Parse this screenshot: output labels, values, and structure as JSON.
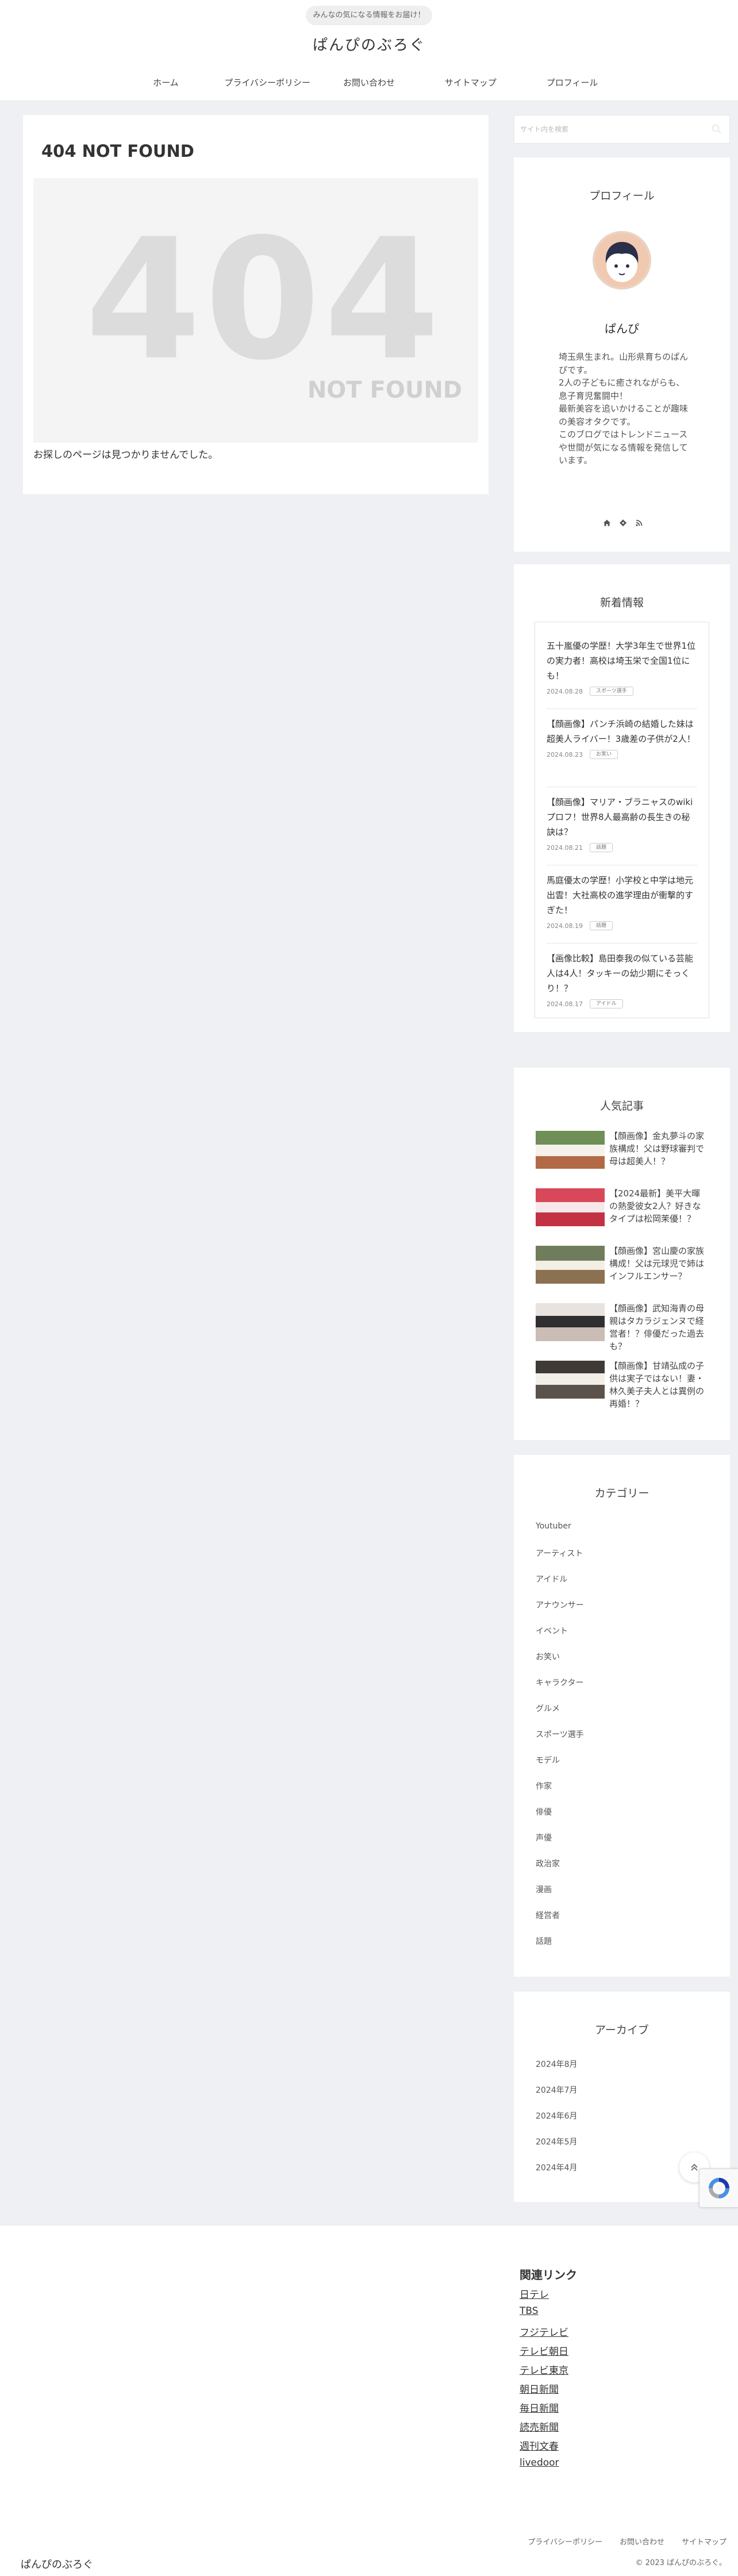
{
  "header": {
    "tagline": "みんなの気になる情報をお届け！",
    "site_title": "ぱんぴのぶろぐ",
    "nav": [
      "ホーム",
      "プライバシーポリシー",
      "お問い合わせ",
      "サイトマップ",
      "プロフィール"
    ]
  },
  "main": {
    "title": "404 NOT FOUND",
    "image_big": "404",
    "image_small": "NOT FOUND",
    "message": "お探しのページは見つかりませんでした。"
  },
  "search": {
    "placeholder": "サイト内を検索"
  },
  "profile": {
    "title": "プロフィール",
    "name": "ぱんぴ",
    "bio": [
      "埼玉県生まれ。山形県育ちのぱんぴです。",
      "2人の子どもに癒されながらも、息子育児奮闘中！",
      "最新美容を追いかけることが趣味の美容オタクです。",
      "このブログではトレンドニュースや世間が気になる情報を発信しています。"
    ],
    "icons": [
      "home-icon",
      "feedly-icon",
      "rss-icon"
    ]
  },
  "newest": {
    "title": "新着情報",
    "items": [
      {
        "title": "五十嵐優の学歴！大学3年生で世界1位の実力者！高校は埼玉栄で全国1位にも！",
        "date": "2024.08.28",
        "category": "スポーツ選手"
      },
      {
        "title": "【顔画像】パンチ浜崎の結婚した妹は超美人ライバー！3歳差の子供が2人！",
        "date": "2024.08.23",
        "category": "お笑い"
      },
      {
        "title": "【顔画像】マリア・ブラニャスのwikiプロフ！世界8人最高齢の長生きの秘訣は？",
        "date": "2024.08.21",
        "category": "話題"
      },
      {
        "title": "馬庭優太の学歴！小学校と中学は地元出雲！大社高校の進学理由が衝撃的すぎた！",
        "date": "2024.08.19",
        "category": "話題"
      },
      {
        "title": "【画像比較】島田泰我の似ている芸能人は4人！タッキーの幼少期にそっくり！？",
        "date": "2024.08.17",
        "category": "アイドル"
      }
    ]
  },
  "popular": {
    "title": "人気記事",
    "items": [
      {
        "title": "【顔画像】金丸夢斗の家族構成！父は野球審判で母は超美人！？",
        "thumb_color": "#8aa36a"
      },
      {
        "title": "【2024最新】美平大暉の熱愛彼女2人？好きなタイプは松岡茉優！？",
        "thumb_color": "#d9485a"
      },
      {
        "title": "【顔画像】宮山慶の家族構成！父は元球児で姉はインフルエンサー？",
        "thumb_color": "#6f7d5c"
      },
      {
        "title": "【顔画像】武知海青の母親はタカラジェンヌで経営者！？俳優だった過去も？",
        "thumb_color": "#d8d1cc"
      },
      {
        "title": "【顔画像】甘靖弘成の子供は実子ではない！妻・林久美子夫人とは異例の再婚！？",
        "thumb_color": "#3f3a36"
      }
    ]
  },
  "category": {
    "title": "カテゴリー",
    "items": [
      "Youtuber",
      "アーティスト",
      "アイドル",
      "アナウンサー",
      "イベント",
      "お笑い",
      "キャラクター",
      "グルメ",
      "スポーツ選手",
      "モデル",
      "作家",
      "俳優",
      "声優",
      "政治家",
      "漫画",
      "経営者",
      "話題"
    ]
  },
  "archive": {
    "title": "アーカイブ",
    "items": [
      "2024年8月",
      "2024年7月",
      "2024年6月",
      "2024年5月",
      "2024年4月"
    ]
  },
  "footer": {
    "links_title": "関連リンク",
    "links": [
      "日テレ",
      "TBS",
      "フジテレビ",
      "テレビ朝日",
      "テレビ東京",
      "朝日新聞",
      "毎日新聞",
      "読売新聞",
      "週刊文春",
      "livedoor"
    ],
    "nav": [
      "プライバシーポリシー",
      "お問い合わせ",
      "サイトマップ"
    ],
    "logo": "ぱんぴのぶろぐ",
    "copyright": "© 2023 ぱんぴのぶろぐ。"
  },
  "pagetop_icon": "chevron-up-icon"
}
